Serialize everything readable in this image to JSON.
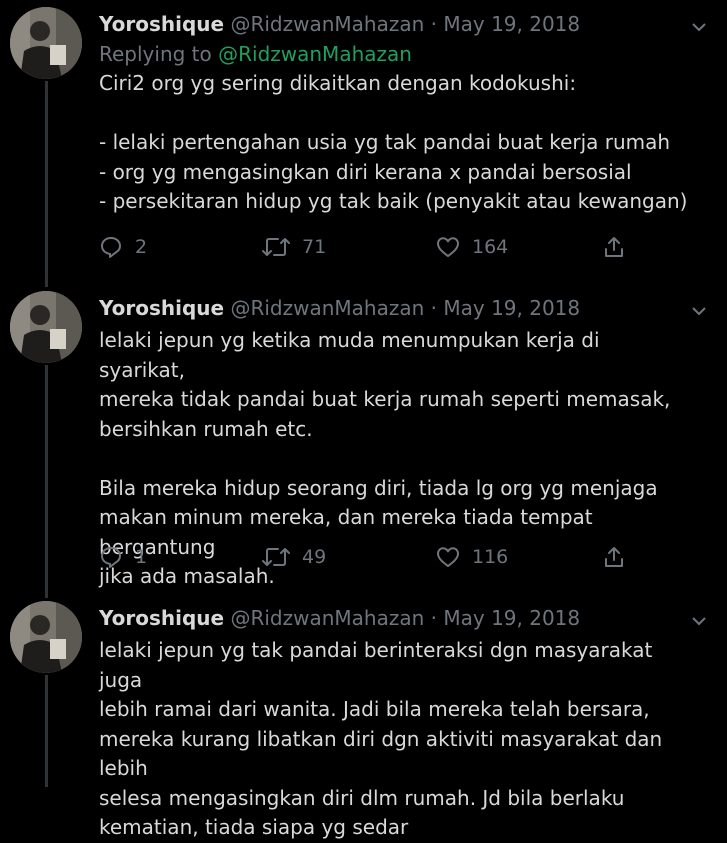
{
  "tweets": [
    {
      "name": "Yoroshique",
      "handle": "@RidzwanMahazan",
      "separator": "·",
      "date": "May 19, 2018",
      "replying_prefix": "Replying to",
      "replying_handle": "@RidzwanMahazan",
      "text": "Ciri2 org yg sering dikaitkan dengan kodokushi:\n\n- lelaki pertengahan usia yg tak pandai buat kerja rumah\n- org yg mengasingkan diri kerana x pandai bersosial\n- persekitaran hidup yg tak baik (penyakit atau kewangan)",
      "replies": "2",
      "retweets": "71",
      "likes": "164"
    },
    {
      "name": "Yoroshique",
      "handle": "@RidzwanMahazan",
      "separator": "·",
      "date": "May 19, 2018",
      "text": "lelaki jepun yg ketika muda menumpukan kerja di syarikat,\nmereka tidak pandai buat kerja rumah seperti memasak,\nbersihkan rumah etc.\n\nBila mereka hidup seorang diri, tiada lg org yg menjaga\nmakan minum mereka, dan mereka tiada tempat bergantung\njika ada masalah.",
      "replies": "1",
      "retweets": "49",
      "likes": "116"
    },
    {
      "name": "Yoroshique",
      "handle": "@RidzwanMahazan",
      "separator": "·",
      "date": "May 19, 2018",
      "text": "lelaki jepun yg tak pandai berinteraksi dgn masyarakat juga\nlebih ramai dari wanita. Jadi bila mereka telah bersara,\nmereka kurang libatkan diri dgn aktiviti masyarakat dan lebih\nselesa mengasingkan diri dlm rumah. Jd bila berlaku\nkematian, tiada siapa yg sedar"
    }
  ],
  "icons": {
    "reply": "reply-icon",
    "retweet": "retweet-icon",
    "like": "heart-icon",
    "share": "share-icon",
    "more": "chevron-down-icon"
  },
  "colors": {
    "background": "#000000",
    "text": "#d9d9d9",
    "muted": "#6e767d",
    "mention": "#1fa05e",
    "thread_line": "#2f3336"
  }
}
